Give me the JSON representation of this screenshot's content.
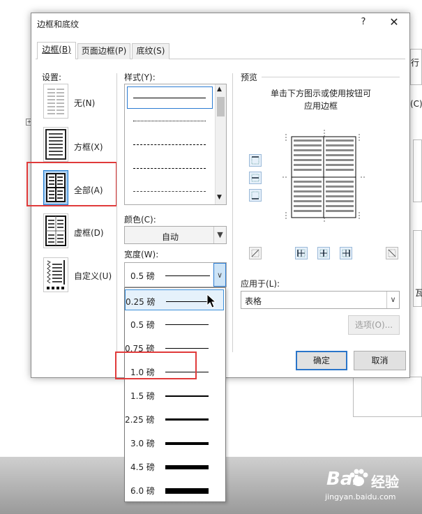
{
  "dialog": {
    "title": "边框和底纹",
    "help": "?",
    "close": "✕",
    "tabs": [
      {
        "label": "边框(B)",
        "active": true
      },
      {
        "label": "页面边框(P)",
        "active": false
      },
      {
        "label": "底纹(S)",
        "active": false
      }
    ],
    "settings_label": "设置:",
    "settings": [
      {
        "label": "无(N)",
        "icon": "no-border-icon",
        "selected": false
      },
      {
        "label": "方框(X)",
        "icon": "box-border-icon",
        "selected": false
      },
      {
        "label": "全部(A)",
        "icon": "all-borders-icon",
        "selected": true
      },
      {
        "label": "虚框(D)",
        "icon": "grid-border-icon",
        "selected": false
      },
      {
        "label": "自定义(U)",
        "icon": "custom-border-icon",
        "selected": false
      }
    ],
    "style_label": "样式(Y):",
    "color_label": "颜色(C):",
    "color_value": "自动",
    "width_label": "宽度(W):",
    "width_value": "0.5 磅",
    "preview_label": "预览",
    "preview_hint_line1": "单击下方图示或使用按钮可",
    "preview_hint_line2": "应用边框",
    "apply_to_label": "应用于(L):",
    "apply_to_value": "表格",
    "options_button": "选项(O)...",
    "ok_button": "确定",
    "cancel_button": "取消"
  },
  "width_options": [
    {
      "label": "0.25 磅",
      "thickness_pt": 0.25,
      "hover": true
    },
    {
      "label": "0.5 磅",
      "thickness_pt": 0.5
    },
    {
      "label": "0.75 磅",
      "thickness_pt": 0.75
    },
    {
      "label": "1.0 磅",
      "thickness_pt": 1.0,
      "highlighted": true
    },
    {
      "label": "1.5 磅",
      "thickness_pt": 1.5
    },
    {
      "label": "2.25 磅",
      "thickness_pt": 2.25
    },
    {
      "label": "3.0 磅",
      "thickness_pt": 3.0
    },
    {
      "label": "4.5 磅",
      "thickness_pt": 4.5
    },
    {
      "label": "6.0 磅",
      "thickness_pt": 6.0
    }
  ],
  "background": {
    "right_text_1": "行",
    "right_text_2": "(C)",
    "right_text_3": "瓦"
  },
  "watermark": {
    "brand": "Bai",
    "brand2": "经验",
    "url": "jingyan.baidu.com"
  },
  "colors": {
    "accent": "#2a75c9",
    "highlight_red": "#e03a3a",
    "selected_bg": "#d7e9fb"
  }
}
